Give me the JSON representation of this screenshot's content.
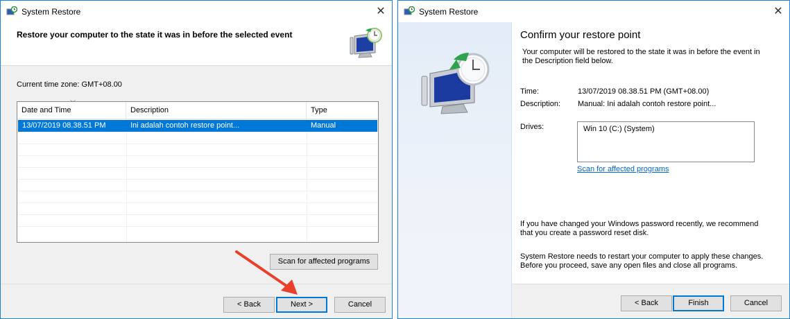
{
  "left_window": {
    "title": "System Restore",
    "close_glyph": "✕",
    "header_text": "Restore your computer to the state it was in before the selected event",
    "timezone_label": "Current time zone: GMT+08.00",
    "table": {
      "columns": [
        "Date and Time",
        "Description",
        "Type"
      ],
      "rows": [
        {
          "date": "13/07/2019 08.38.51 PM",
          "description": "Ini adalah contoh restore point...",
          "type": "Manual"
        }
      ]
    },
    "scan_button": "Scan for affected programs",
    "back_button": "< Back",
    "next_button": "Next >",
    "cancel_button": "Cancel",
    "annotation_arrow_color": "#e8402a"
  },
  "right_window": {
    "title": "System Restore",
    "close_glyph": "✕",
    "heading": "Confirm your restore point",
    "description": "Your computer will be restored to the state it was in before the event in the Description field below.",
    "time_label": "Time:",
    "time_value": "13/07/2019 08.38.51 PM (GMT+08.00)",
    "description_label": "Description:",
    "description_value": "Manual: Ini adalah contoh restore point...",
    "drives_label": "Drives:",
    "drives_value": "Win 10 (C:) (System)",
    "scan_link": "Scan for affected programs",
    "password_note": "If you have changed your Windows password recently, we recommend that you create a password reset disk.",
    "restart_note": "System Restore needs to restart your computer to apply these changes. Before you proceed, save any open files and close all programs.",
    "back_button": "< Back",
    "finish_button": "Finish",
    "cancel_button": "Cancel"
  },
  "colors": {
    "window_border": "#1883d7",
    "selection": "#0078d7",
    "link": "#0066cc"
  }
}
